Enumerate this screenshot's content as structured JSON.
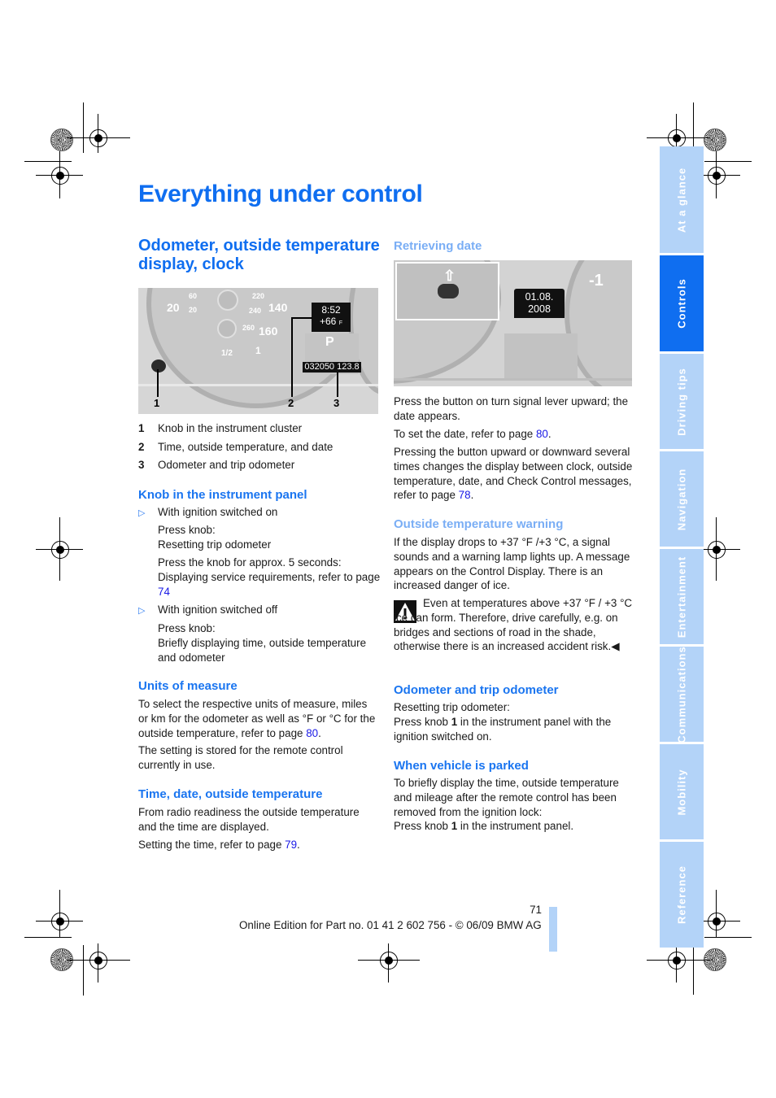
{
  "page": {
    "title": "Everything under control",
    "section_title": "Odometer, outside temperature display, clock",
    "page_number": "71",
    "footer": "Online Edition for Part no. 01 41 2 602 756 - © 06/09 BMW AG"
  },
  "side_tabs": [
    {
      "label": "At a glance",
      "active": false
    },
    {
      "label": "Controls",
      "active": true
    },
    {
      "label": "Driving tips",
      "active": false
    },
    {
      "label": "Navigation",
      "active": false
    },
    {
      "label": "Entertainment",
      "active": false
    },
    {
      "label": "Communications",
      "active": false
    },
    {
      "label": "Mobility",
      "active": false
    },
    {
      "label": "Reference",
      "active": false
    }
  ],
  "figure1": {
    "gauge_labels": [
      "20",
      "60",
      "20",
      "140",
      "220",
      "240",
      "260",
      "160",
      "1/2",
      "1"
    ],
    "clock": "8:52",
    "temp": "+66",
    "temp_unit": "F",
    "gear": "P",
    "odometer": "032050",
    "trip": "123.8",
    "callouts": [
      "1",
      "2",
      "3"
    ]
  },
  "figure2": {
    "date_line1": "01.08.",
    "date_line2": "2008",
    "gauge_label": "-1"
  },
  "legend": [
    {
      "num": "1",
      "text": "Knob in the instrument cluster"
    },
    {
      "num": "2",
      "text": "Time, outside temperature, and date"
    },
    {
      "num": "3",
      "text": "Odometer and trip odometer"
    }
  ],
  "left": {
    "knob_heading": "Knob in the instrument panel",
    "bullet1": "With ignition switched on",
    "b1_p1_l1": "Press knob:",
    "b1_p1_l2": "Resetting trip odometer",
    "b1_p2": "Press the knob for approx. 5 seconds: Displaying service requirements, refer to page ",
    "b1_p2_link": "74",
    "bullet2": "With ignition switched off",
    "b2_p1_l1": "Press knob:",
    "b2_p1_l2": "Briefly displaying time, outside temperature and odometer",
    "units_heading": "Units of measure",
    "units_p1": "To select the respective units of measure, miles or km for the odometer as well as °F or °C for the outside temperature, refer to page ",
    "units_p1_link": "80",
    "units_p2": "The setting is stored for the remote control currently in use.",
    "time_heading": "Time, date, outside temperature",
    "time_p1": "From radio readiness the outside temperature and the time are displayed.",
    "time_p2": "Setting the time, refer to page ",
    "time_p2_link": "79"
  },
  "right": {
    "retrieving_heading": "Retrieving date",
    "ret_p1": "Press the button on turn signal lever upward; the date appears.",
    "ret_p2": "To set the date, refer to page ",
    "ret_p2_link": "80",
    "ret_p3": "Pressing the button upward or downward several times changes the display between clock, outside temperature, date, and Check Control messages, refer to page ",
    "ret_p3_link": "78",
    "warn_heading": "Outside temperature warning",
    "warn_p1": "If the display drops to +37 °F /+3 °C, a signal sounds and a warning lamp lights up. A message appears on the Control Display. There is an increased danger of ice.",
    "warn_note": "Even at temperatures above +37 °F / +3 °C ice can form. Therefore, drive carefully, e.g. on bridges and sections of road in the shade, otherwise there is an increased accident risk.",
    "odo_heading": "Odometer and trip odometer",
    "odo_l1": "Resetting trip odometer:",
    "odo_l2a": "Press knob ",
    "odo_l2b": "1",
    "odo_l2c": " in the instrument panel with the ignition switched on.",
    "parked_heading": "When vehicle is parked",
    "parked_p1": "To briefly display the time, outside temperature and mileage after the remote control has been removed from the ignition lock:",
    "parked_l2a": "Press knob ",
    "parked_l2b": "1",
    "parked_l2c": " in the instrument panel."
  }
}
